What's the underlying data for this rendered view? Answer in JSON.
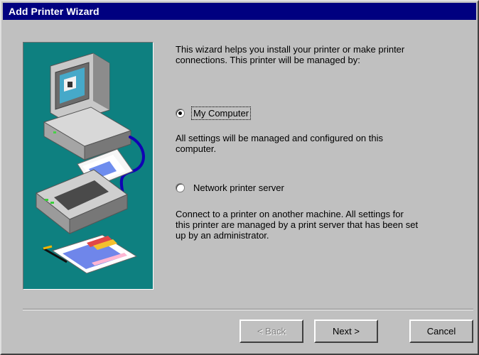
{
  "window": {
    "title": "Add Printer Wizard"
  },
  "intro": {
    "text": "This wizard helps you install your printer or make printer\nconnections.  This printer will be managed by:"
  },
  "options": [
    {
      "label": "My Computer",
      "selected": true,
      "description": "All settings will be managed and configured on this\ncomputer."
    },
    {
      "label": "Network printer server",
      "selected": false,
      "description": "Connect to a printer on another machine.  All settings for\nthis printer are managed by a print server that has been set\nup by an administrator."
    }
  ],
  "buttons": {
    "back": {
      "label": "< Back",
      "enabled": false
    },
    "next": {
      "label": "Next >",
      "enabled": true
    },
    "cancel": {
      "label": "Cancel",
      "enabled": true
    }
  },
  "colors": {
    "title_bar": "#000080",
    "dialog_background": "#c0c0c0",
    "illustration_background": "#0e8080"
  }
}
